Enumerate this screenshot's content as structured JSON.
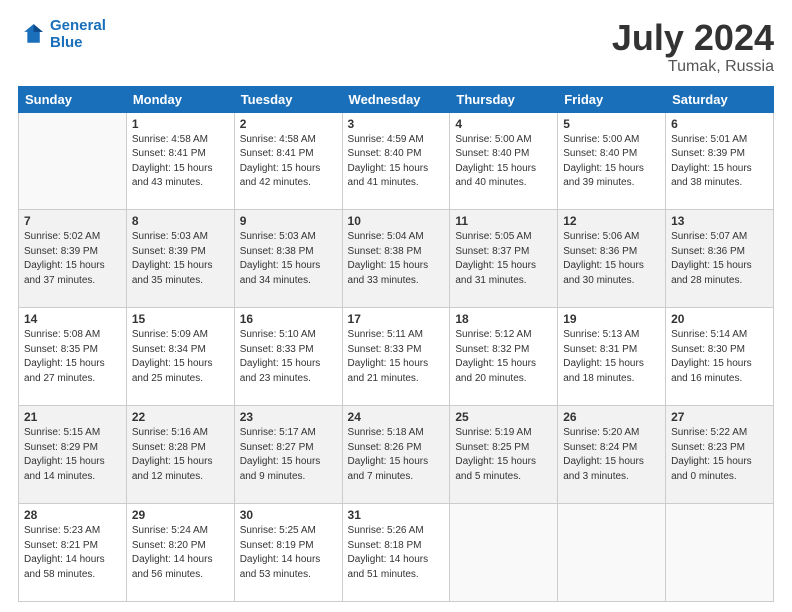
{
  "header": {
    "logo_line1": "General",
    "logo_line2": "Blue",
    "title": "July 2024",
    "location": "Tumak, Russia"
  },
  "weekdays": [
    "Sunday",
    "Monday",
    "Tuesday",
    "Wednesday",
    "Thursday",
    "Friday",
    "Saturday"
  ],
  "weeks": [
    [
      {
        "day": "",
        "detail": ""
      },
      {
        "day": "1",
        "detail": "Sunrise: 4:58 AM\nSunset: 8:41 PM\nDaylight: 15 hours\nand 43 minutes."
      },
      {
        "day": "2",
        "detail": "Sunrise: 4:58 AM\nSunset: 8:41 PM\nDaylight: 15 hours\nand 42 minutes."
      },
      {
        "day": "3",
        "detail": "Sunrise: 4:59 AM\nSunset: 8:40 PM\nDaylight: 15 hours\nand 41 minutes."
      },
      {
        "day": "4",
        "detail": "Sunrise: 5:00 AM\nSunset: 8:40 PM\nDaylight: 15 hours\nand 40 minutes."
      },
      {
        "day": "5",
        "detail": "Sunrise: 5:00 AM\nSunset: 8:40 PM\nDaylight: 15 hours\nand 39 minutes."
      },
      {
        "day": "6",
        "detail": "Sunrise: 5:01 AM\nSunset: 8:39 PM\nDaylight: 15 hours\nand 38 minutes."
      }
    ],
    [
      {
        "day": "7",
        "detail": "Sunrise: 5:02 AM\nSunset: 8:39 PM\nDaylight: 15 hours\nand 37 minutes."
      },
      {
        "day": "8",
        "detail": "Sunrise: 5:03 AM\nSunset: 8:39 PM\nDaylight: 15 hours\nand 35 minutes."
      },
      {
        "day": "9",
        "detail": "Sunrise: 5:03 AM\nSunset: 8:38 PM\nDaylight: 15 hours\nand 34 minutes."
      },
      {
        "day": "10",
        "detail": "Sunrise: 5:04 AM\nSunset: 8:38 PM\nDaylight: 15 hours\nand 33 minutes."
      },
      {
        "day": "11",
        "detail": "Sunrise: 5:05 AM\nSunset: 8:37 PM\nDaylight: 15 hours\nand 31 minutes."
      },
      {
        "day": "12",
        "detail": "Sunrise: 5:06 AM\nSunset: 8:36 PM\nDaylight: 15 hours\nand 30 minutes."
      },
      {
        "day": "13",
        "detail": "Sunrise: 5:07 AM\nSunset: 8:36 PM\nDaylight: 15 hours\nand 28 minutes."
      }
    ],
    [
      {
        "day": "14",
        "detail": "Sunrise: 5:08 AM\nSunset: 8:35 PM\nDaylight: 15 hours\nand 27 minutes."
      },
      {
        "day": "15",
        "detail": "Sunrise: 5:09 AM\nSunset: 8:34 PM\nDaylight: 15 hours\nand 25 minutes."
      },
      {
        "day": "16",
        "detail": "Sunrise: 5:10 AM\nSunset: 8:33 PM\nDaylight: 15 hours\nand 23 minutes."
      },
      {
        "day": "17",
        "detail": "Sunrise: 5:11 AM\nSunset: 8:33 PM\nDaylight: 15 hours\nand 21 minutes."
      },
      {
        "day": "18",
        "detail": "Sunrise: 5:12 AM\nSunset: 8:32 PM\nDaylight: 15 hours\nand 20 minutes."
      },
      {
        "day": "19",
        "detail": "Sunrise: 5:13 AM\nSunset: 8:31 PM\nDaylight: 15 hours\nand 18 minutes."
      },
      {
        "day": "20",
        "detail": "Sunrise: 5:14 AM\nSunset: 8:30 PM\nDaylight: 15 hours\nand 16 minutes."
      }
    ],
    [
      {
        "day": "21",
        "detail": "Sunrise: 5:15 AM\nSunset: 8:29 PM\nDaylight: 15 hours\nand 14 minutes."
      },
      {
        "day": "22",
        "detail": "Sunrise: 5:16 AM\nSunset: 8:28 PM\nDaylight: 15 hours\nand 12 minutes."
      },
      {
        "day": "23",
        "detail": "Sunrise: 5:17 AM\nSunset: 8:27 PM\nDaylight: 15 hours\nand 9 minutes."
      },
      {
        "day": "24",
        "detail": "Sunrise: 5:18 AM\nSunset: 8:26 PM\nDaylight: 15 hours\nand 7 minutes."
      },
      {
        "day": "25",
        "detail": "Sunrise: 5:19 AM\nSunset: 8:25 PM\nDaylight: 15 hours\nand 5 minutes."
      },
      {
        "day": "26",
        "detail": "Sunrise: 5:20 AM\nSunset: 8:24 PM\nDaylight: 15 hours\nand 3 minutes."
      },
      {
        "day": "27",
        "detail": "Sunrise: 5:22 AM\nSunset: 8:23 PM\nDaylight: 15 hours\nand 0 minutes."
      }
    ],
    [
      {
        "day": "28",
        "detail": "Sunrise: 5:23 AM\nSunset: 8:21 PM\nDaylight: 14 hours\nand 58 minutes."
      },
      {
        "day": "29",
        "detail": "Sunrise: 5:24 AM\nSunset: 8:20 PM\nDaylight: 14 hours\nand 56 minutes."
      },
      {
        "day": "30",
        "detail": "Sunrise: 5:25 AM\nSunset: 8:19 PM\nDaylight: 14 hours\nand 53 minutes."
      },
      {
        "day": "31",
        "detail": "Sunrise: 5:26 AM\nSunset: 8:18 PM\nDaylight: 14 hours\nand 51 minutes."
      },
      {
        "day": "",
        "detail": ""
      },
      {
        "day": "",
        "detail": ""
      },
      {
        "day": "",
        "detail": ""
      }
    ]
  ]
}
